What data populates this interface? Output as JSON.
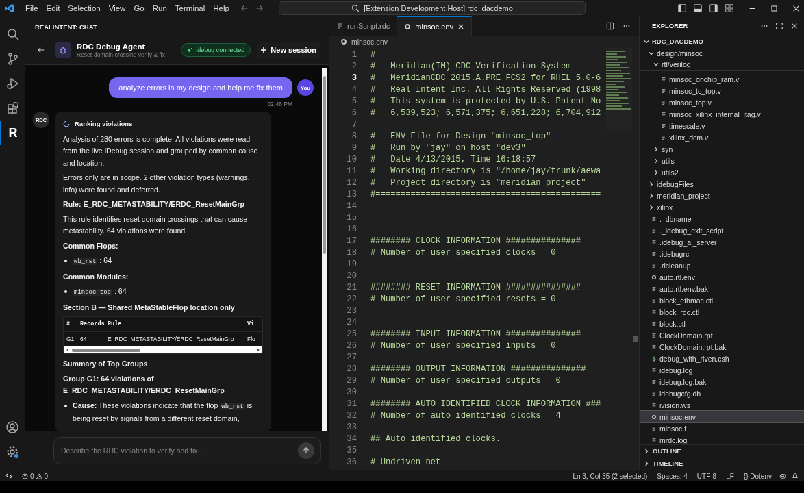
{
  "menu_bar": {
    "items": [
      "File",
      "Edit",
      "Selection",
      "View",
      "Go",
      "Run",
      "Terminal",
      "Help"
    ],
    "command_center": "[Extension Development Host] rdc_dacdemo"
  },
  "activity_bar": {
    "items": [
      {
        "kind": "search",
        "selected": false
      },
      {
        "kind": "source_control",
        "selected": false
      },
      {
        "kind": "run_debug",
        "selected": false
      },
      {
        "kind": "extensions",
        "selected": false
      },
      {
        "kind": "letter",
        "label": "R",
        "selected": true
      }
    ]
  },
  "chat": {
    "panel_title": "REALINTENT: CHAT",
    "agent": {
      "name": "RDC Debug Agent",
      "subtitle": "Reset-domain-crossing verify & fix"
    },
    "connection_badge": "idebug connected",
    "new_session_button": "New session",
    "user_message": {
      "text": "analyze errors in my design and help me fix them",
      "avatar": "You",
      "time": "02:48 PM"
    },
    "bot_message": {
      "avatar": "RDC",
      "blocks": [
        {
          "kind": "status",
          "text": "Ranking violations"
        },
        {
          "kind": "paragraph",
          "text": "Analysis of 280 errors is complete. All violations were read from the live iDebug session and grouped by common cause and location."
        },
        {
          "kind": "paragraph",
          "text": "Errors only are in scope. 2 other violation types (warnings, info) were found and deferred."
        },
        {
          "kind": "heading",
          "text": "Rule: E_RDC_METASTABILITY/ERDC_ResetMainGrp"
        },
        {
          "kind": "paragraph",
          "text": "This rule identifies reset domain crossings that can cause metastability. 64 violations were found."
        },
        {
          "kind": "heading",
          "text": "Common Flops:"
        },
        {
          "kind": "bullet",
          "parts": [
            {
              "kind": "code",
              "text": "wb_rst"
            },
            {
              "kind": "plain",
              "text": " : 64"
            }
          ]
        },
        {
          "kind": "heading",
          "text": "Common Modules:"
        },
        {
          "kind": "bullet",
          "parts": [
            {
              "kind": "code",
              "text": "minsoc_top"
            },
            {
              "kind": "plain",
              "text": " : 64"
            }
          ]
        },
        {
          "kind": "heading",
          "text": "Section B — Shared MetaStableFlop location only"
        },
        {
          "kind": "table",
          "columns": [
            "#",
            "Records",
            "Rule",
            "Vi"
          ],
          "rows": [
            [
              "G1",
              "64",
              "E_RDC_METASTABILITY/ERDC_ResetMainGrp",
              "Flo"
            ]
          ]
        },
        {
          "kind": "heading",
          "text": "Summary of Top Groups"
        },
        {
          "kind": "heading",
          "text": "Group G1: 64 violations of E_RDC_METASTABILITY/ERDC_ResetMainGrp"
        },
        {
          "kind": "bullet",
          "parts": [
            {
              "kind": "bold",
              "text": "Cause:"
            },
            {
              "kind": "plain",
              "text": " These violations indicate that the flop "
            },
            {
              "kind": "code",
              "text": "wb_rst"
            },
            {
              "kind": "plain",
              "text": " is being reset by signals from a different reset domain,"
            }
          ]
        }
      ]
    },
    "input": {
      "placeholder": "Describe the RDC violation to verify and fix..."
    }
  },
  "editor": {
    "tabs": [
      {
        "label": "runScript.rdc",
        "kind": "file",
        "selected": false
      },
      {
        "label": "minsoc.env",
        "kind": "env",
        "selected": true
      }
    ],
    "breadcrumb": "minsoc.env",
    "lines": [
      {
        "number": "1",
        "text": "#=============================================",
        "current": false
      },
      {
        "number": "2",
        "text": "#   Meridian(TM) CDC Verification System",
        "current": false
      },
      {
        "number": "3",
        "text": "#   MeridianCDC 2015.A.PRE_FCS2 for RHEL 5.0-6",
        "current": true
      },
      {
        "number": "4",
        "text": "#   Real Intent Inc. All Rights Reserved (1998",
        "current": false
      },
      {
        "number": "5",
        "text": "#   This system is protected by U.S. Patent No",
        "current": false
      },
      {
        "number": "6",
        "text": "#   6,539,523; 6,571,375; 6,651,228; 6,704,912",
        "current": false
      },
      {
        "number": "7",
        "current": false
      },
      {
        "number": "8",
        "text": "#   ENV File for Design \"minsoc_top\"",
        "current": false
      },
      {
        "number": "9",
        "text": "#   Run by \"jay\" on host \"dev3\"",
        "current": false
      },
      {
        "number": "10",
        "text": "#   Date 4/13/2015, Time 16:18:57",
        "current": false
      },
      {
        "number": "11",
        "text": "#   Working directory is \"/home/jay/trunk/aewa",
        "current": false
      },
      {
        "number": "12",
        "text": "#   Project directory is \"meridian_project\"",
        "current": false
      },
      {
        "number": "13",
        "text": "#=============================================",
        "current": false
      },
      {
        "number": "14",
        "current": false
      },
      {
        "number": "15",
        "current": false
      },
      {
        "number": "16",
        "current": false
      },
      {
        "number": "17",
        "text": "######## CLOCK INFORMATION ###############",
        "current": false
      },
      {
        "number": "18",
        "text": "# Number of user specified clocks = 0",
        "current": false
      },
      {
        "number": "19",
        "current": false
      },
      {
        "number": "20",
        "current": false
      },
      {
        "number": "21",
        "text": "######## RESET INFORMATION ###############",
        "current": false
      },
      {
        "number": "22",
        "text": "# Number of user specified resets = 0",
        "current": false
      },
      {
        "number": "23",
        "current": false
      },
      {
        "number": "24",
        "current": false
      },
      {
        "number": "25",
        "text": "######## INPUT INFORMATION ###############",
        "current": false
      },
      {
        "number": "26",
        "text": "# Number of user specified inputs = 0",
        "current": false
      },
      {
        "number": "27",
        "current": false
      },
      {
        "number": "28",
        "text": "######## OUTPUT INFORMATION ###############",
        "current": false
      },
      {
        "number": "29",
        "text": "# Number of user specified outputs = 0",
        "current": false
      },
      {
        "number": "30",
        "current": false
      },
      {
        "number": "31",
        "text": "######## AUTO IDENTIFIED CLOCK INFORMATION ###",
        "current": false
      },
      {
        "number": "32",
        "text": "# Number of auto identified clocks = 4",
        "current": false
      },
      {
        "number": "33",
        "current": false
      },
      {
        "number": "34",
        "text": "## Auto identified clocks.",
        "current": false
      },
      {
        "number": "35",
        "current": false
      },
      {
        "number": "36",
        "text": "# Undriven net",
        "current": false
      }
    ]
  },
  "explorer": {
    "title": "EXPLORER",
    "tree": [
      {
        "label": "RDC_DACDEMO",
        "kind": "folder",
        "expanded": true,
        "selected": false,
        "children": [
          {
            "label": "design/minsoc",
            "kind": "folder",
            "expanded": true,
            "selected": false,
            "children": [
              {
                "label": "rtl/verilog",
                "kind": "folder",
                "expanded": true,
                "selected": false,
                "children": [
                  {
                    "label": "minsoc_onchip_ram.v",
                    "kind": "file",
                    "selected": false
                  },
                  {
                    "label": "minsoc_tc_top.v",
                    "kind": "file",
                    "selected": false
                  },
                  {
                    "label": "minsoc_top.v",
                    "kind": "file",
                    "selected": false
                  },
                  {
                    "label": "minsoc_xilinx_internal_jtag.v",
                    "kind": "file",
                    "selected": false
                  },
                  {
                    "label": "timescale.v",
                    "kind": "file",
                    "selected": false
                  },
                  {
                    "label": "xilinx_dcm.v",
                    "kind": "file",
                    "selected": false
                  }
                ]
              },
              {
                "label": "syn",
                "kind": "folder",
                "expanded": false,
                "selected": false
              },
              {
                "label": "utils",
                "kind": "folder",
                "expanded": false,
                "selected": false
              },
              {
                "label": "utils2",
                "kind": "folder",
                "expanded": false,
                "selected": false
              }
            ]
          },
          {
            "label": "idebugFiles",
            "kind": "folder",
            "expanded": false,
            "selected": false
          },
          {
            "label": "meridian_project",
            "kind": "folder",
            "expanded": false,
            "selected": false
          },
          {
            "label": "xilinx",
            "kind": "folder",
            "expanded": false,
            "selected": false
          },
          {
            "label": "._dbname",
            "kind": "file",
            "selected": false
          },
          {
            "label": "._idebug_exit_script",
            "kind": "file",
            "selected": false
          },
          {
            "label": ".idebug_ai_server",
            "kind": "file",
            "selected": false
          },
          {
            "label": ".idebugrc",
            "kind": "file",
            "selected": false
          },
          {
            "label": ".ricleanup",
            "kind": "file",
            "selected": false
          },
          {
            "label": "auto.rtl.env",
            "kind": "env",
            "selected": false
          },
          {
            "label": "auto.rtl.env.bak",
            "kind": "file",
            "selected": false
          },
          {
            "label": "block_ethmac.ctl",
            "kind": "file",
            "selected": false
          },
          {
            "label": "block_rdc.ctl",
            "kind": "file",
            "selected": false
          },
          {
            "label": "block.ctl",
            "kind": "file",
            "selected": false
          },
          {
            "label": "ClockDomain.rpt",
            "kind": "file",
            "selected": false
          },
          {
            "label": "ClockDomain.rpt.bak",
            "kind": "file",
            "selected": false
          },
          {
            "label": "debug_with_riven.csh",
            "kind": "shell",
            "selected": false
          },
          {
            "label": "idebug.log",
            "kind": "file",
            "selected": false
          },
          {
            "label": "idebug.log.bak",
            "kind": "file",
            "selected": false
          },
          {
            "label": "idebugcfg.db",
            "kind": "file",
            "selected": false
          },
          {
            "label": "ivision.ws",
            "kind": "file",
            "selected": false
          },
          {
            "label": "minsoc.env",
            "kind": "env",
            "selected": true
          },
          {
            "label": "minsoc.f",
            "kind": "file",
            "selected": false
          },
          {
            "label": "mrdc.log",
            "kind": "file",
            "selected": false
          }
        ]
      }
    ],
    "sections": [
      {
        "label": "OUTLINE",
        "expanded": false
      },
      {
        "label": "TIMELINE",
        "expanded": false
      }
    ]
  },
  "status_bar": {
    "errors": "0",
    "warnings": "0",
    "items": [
      "Ln 3, Col 35 (2 selected)",
      "Spaces: 4",
      "UTF-8",
      "LF",
      "{} Dotenv"
    ]
  }
}
